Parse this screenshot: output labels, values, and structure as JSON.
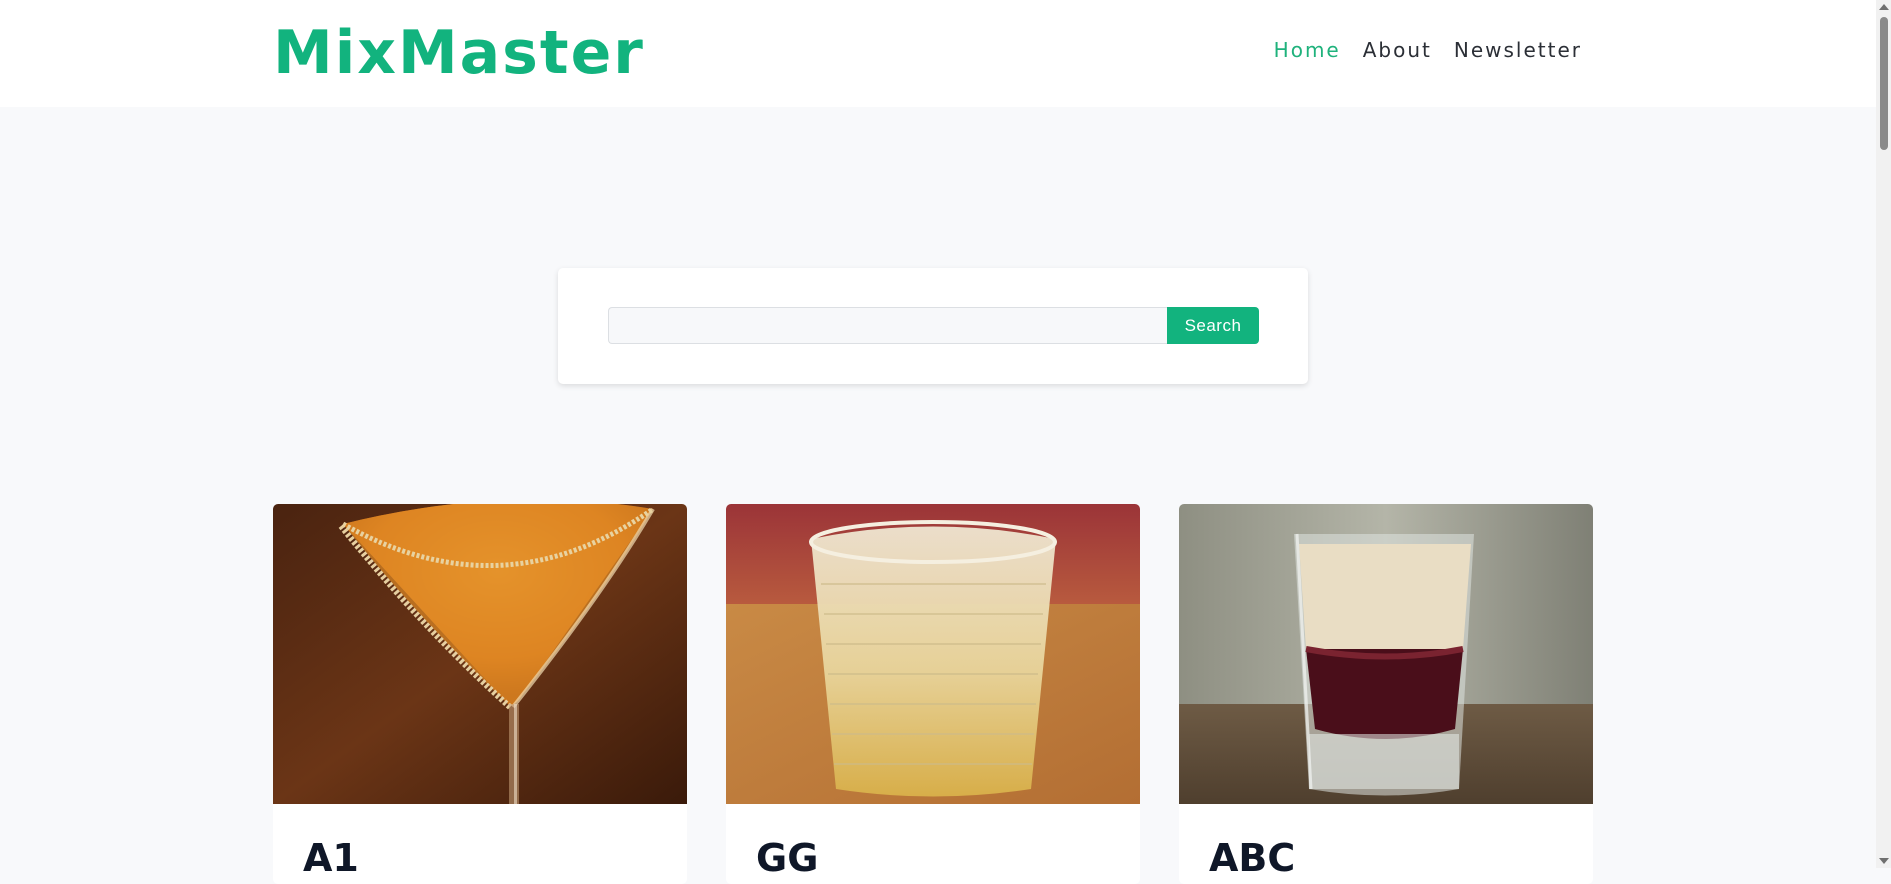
{
  "header": {
    "brand": "MixMaster",
    "nav": [
      {
        "label": "Home",
        "active": true
      },
      {
        "label": "About",
        "active": false
      },
      {
        "label": "Newsletter",
        "active": false
      }
    ]
  },
  "search": {
    "value": "",
    "placeholder": "",
    "button_label": "Search"
  },
  "cocktails": [
    {
      "name": "A1",
      "image_icon": "cocktail-martini-glass-icon"
    },
    {
      "name": "GG",
      "image_icon": "cocktail-rocks-glass-icon"
    },
    {
      "name": "ABC",
      "image_icon": "cocktail-shot-glass-icon"
    }
  ],
  "colors": {
    "brand": "#12b37e",
    "nav_active": "#1fb27c",
    "nav_text": "#2b2f36",
    "page_bg": "#f8f9fb",
    "card_title": "#0f1728"
  }
}
